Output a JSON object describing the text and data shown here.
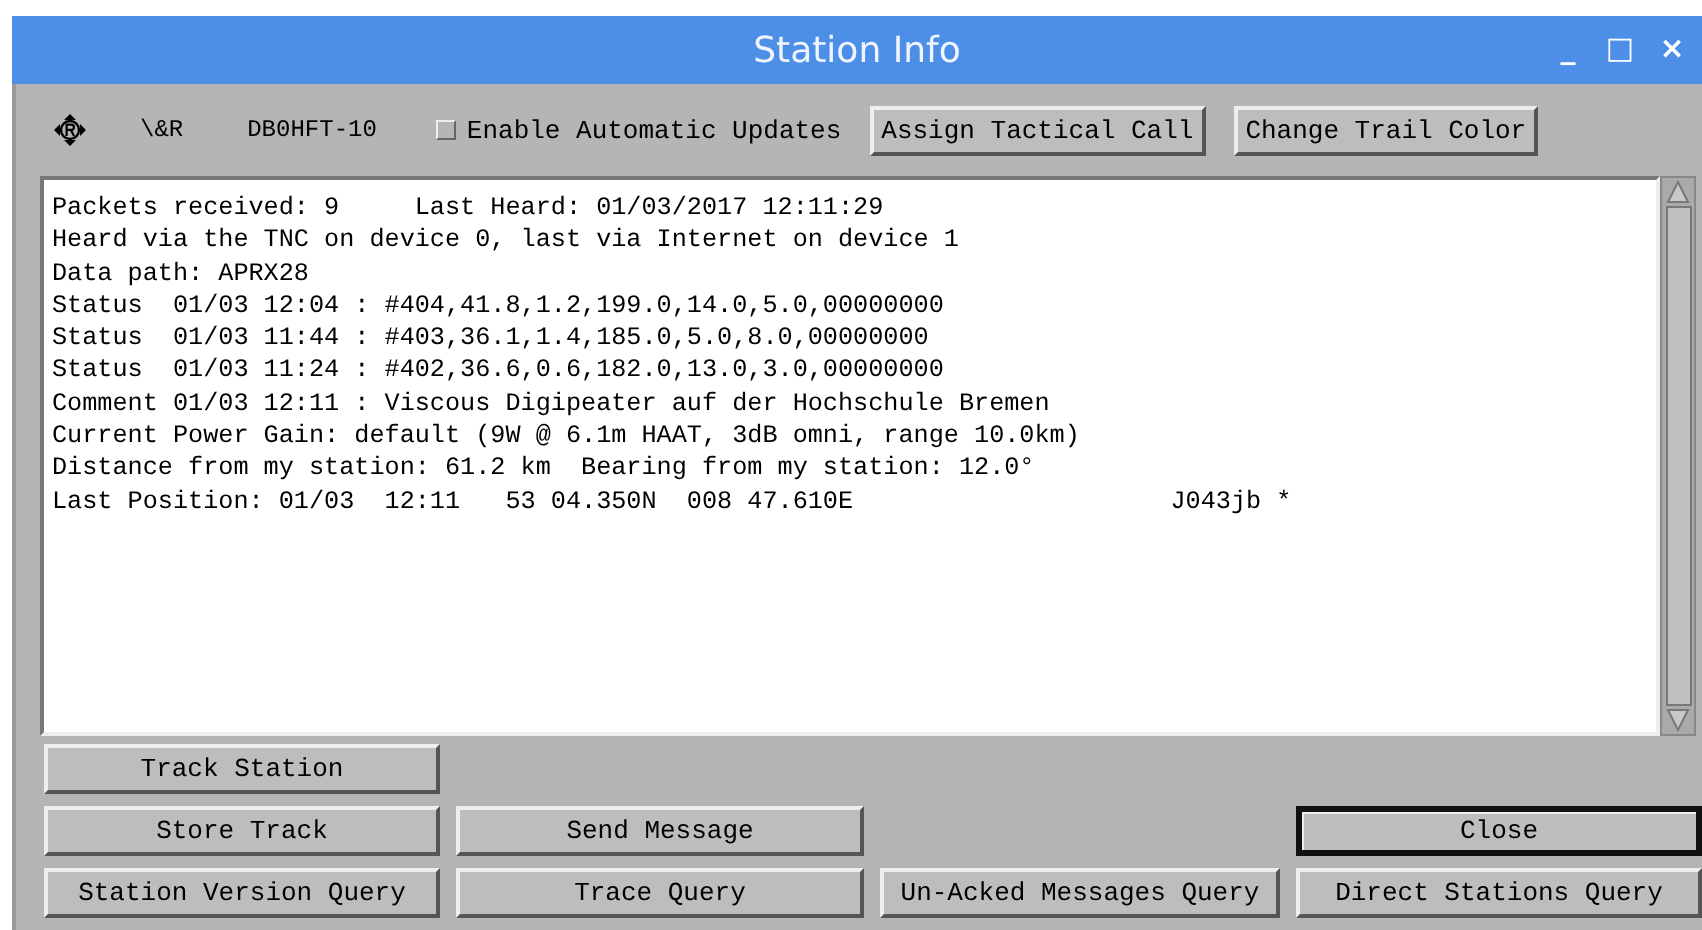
{
  "window": {
    "title": "Station Info",
    "controls": [
      "_",
      "□",
      "×"
    ]
  },
  "toolbar": {
    "symbol": "\\&R",
    "callsign": "DB0HFT-10",
    "auto_update": {
      "label": "Enable Automatic Updates",
      "checked": false
    },
    "buttons": [
      "Assign Tactical Call",
      "Change Trail Color"
    ]
  },
  "info_lines": [
    "Packets received: 9     Last Heard: 01/03/2017 12:11:29",
    "Heard via the TNC on device 0, last via Internet on device 1",
    "Data path: APRX28",
    "Status  01/03 12:04 : #404,41.8,1.2,199.0,14.0,5.0,00000000",
    "Status  01/03 11:44 : #403,36.1,1.4,185.0,5.0,8.0,00000000",
    "Status  01/03 11:24 : #402,36.6,0.6,182.0,13.0,3.0,00000000",
    "Comment 01/03 12:11 : Viscous Digipeater auf der Hochschule Bremen",
    "Current Power Gain: default (9W @ 6.1m HAAT, 3dB omni, range 10.0km)",
    "Distance from my station: 61.2 km  Bearing from my station: 12.0°",
    "Last Position: 01/03  12:11   53 04.350N  008 47.610E                     J043jb *"
  ],
  "button_rows": [
    [
      {
        "label": "Track Station",
        "default": false
      }
    ],
    [
      {
        "label": "Store Track",
        "default": false
      },
      {
        "label": "Send Message",
        "default": false
      },
      {
        "label": "Close",
        "default": true
      }
    ],
    [
      {
        "label": "Station Version Query",
        "default": false
      },
      {
        "label": "Trace Query",
        "default": false
      },
      {
        "label": "Un-Acked Messages Query",
        "default": false
      },
      {
        "label": "Direct Stations Query",
        "default": false
      }
    ]
  ]
}
